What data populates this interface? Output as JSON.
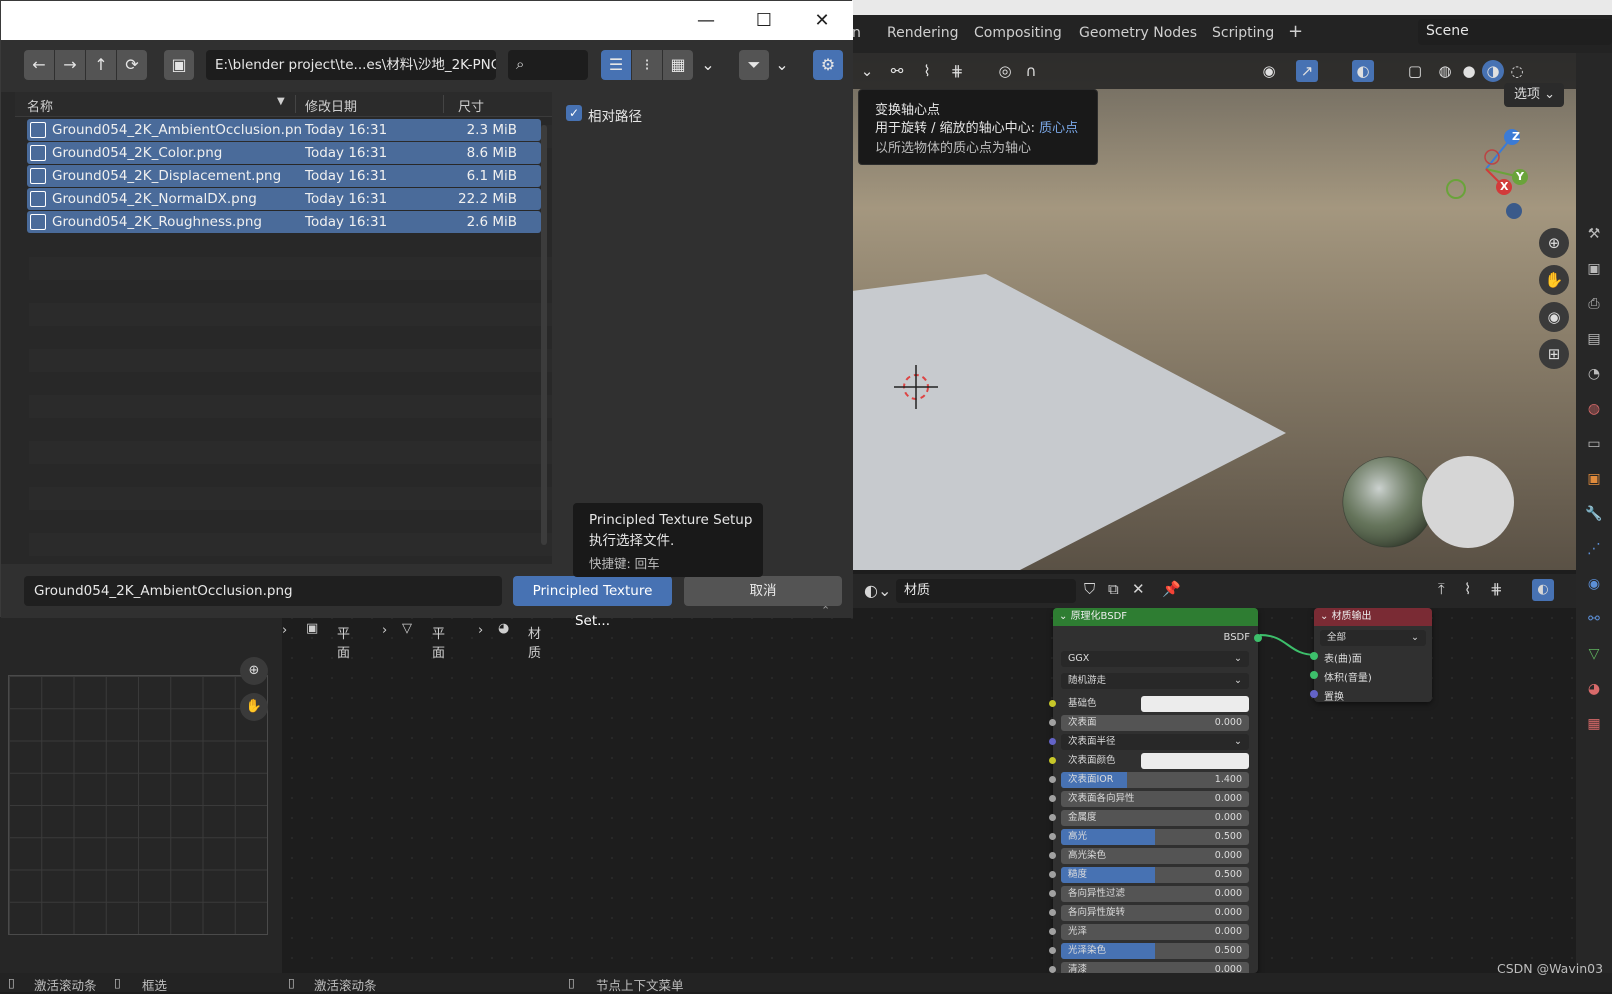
{
  "workspace": {
    "tabs": [
      "n",
      "Rendering",
      "Compositing",
      "Geometry Nodes",
      "Scripting"
    ],
    "add_tab": "+",
    "scene_name": "Scene"
  },
  "viewport": {
    "options_label": "选项",
    "tooltip": {
      "title": "变换轴心点",
      "line2_prefix": "用于旋转 / 缩放的轴心中心: ",
      "line2_value": "质心点",
      "line3": "以所选物体的质心点为轴心"
    },
    "gizmo": {
      "z": "Z",
      "y": "Y",
      "x": "X"
    },
    "plane_color": "#c7cace",
    "sky_top": "#6c675d",
    "sky_mid": "#a4977f"
  },
  "dialog": {
    "path": "E:\\blender project\\te...es\\材料\\沙地_2K-PNG\\",
    "columns": {
      "name": "名称",
      "date": "修改日期",
      "size": "尺寸"
    },
    "files": [
      {
        "name": "Ground054_2K_AmbientOcclusion.pn",
        "date": "Today 16:31",
        "size": "2.3 MiB"
      },
      {
        "name": "Ground054_2K_Color.png",
        "date": "Today 16:31",
        "size": "8.6 MiB"
      },
      {
        "name": "Ground054_2K_Displacement.png",
        "date": "Today 16:31",
        "size": "6.1 MiB"
      },
      {
        "name": "Ground054_2K_NormalDX.png",
        "date": "Today 16:31",
        "size": "22.2 MiB"
      },
      {
        "name": "Ground054_2K_Roughness.png",
        "date": "Today 16:31",
        "size": "2.6 MiB"
      }
    ],
    "relative_path_label": "相对路径",
    "relative_path_checked": true,
    "filename_value": "Ground054_2K_AmbientOcclusion.png",
    "execute_label": "Principled Texture Set...",
    "cancel_label": "取消",
    "tooltip": {
      "title": "Principled Texture Setup",
      "desc": "执行选择文件.",
      "shortcut": "快捷键: 回车"
    },
    "selection_color": "#4a6b9a",
    "accent": "#4772b3"
  },
  "breadcrumbs": [
    "平面",
    "平面",
    "材质"
  ],
  "node_header": {
    "material_label": "材质"
  },
  "bsdf_node": {
    "title": "原理化BSDF",
    "output": "BSDF",
    "distribution": "GGX",
    "subsurface_method": "随机游走",
    "props": [
      {
        "label": "基础色",
        "type": "color"
      },
      {
        "label": "次表面",
        "value": "0.000"
      },
      {
        "label": "次表面半径",
        "type": "dropdown"
      },
      {
        "label": "次表面颜色",
        "type": "color"
      },
      {
        "label": "次表面IOR",
        "value": "1.400",
        "fill": 1.0
      },
      {
        "label": "次表面各向异性",
        "value": "0.000"
      },
      {
        "label": "金属度",
        "value": "0.000"
      },
      {
        "label": "高光",
        "value": "0.500",
        "fill": 0.5
      },
      {
        "label": "高光染色",
        "value": "0.000"
      },
      {
        "label": "糙度",
        "value": "0.500",
        "fill": 0.5
      },
      {
        "label": "各向异性过滤",
        "value": "0.000"
      },
      {
        "label": "各向异性旋转",
        "value": "0.000"
      },
      {
        "label": "光泽",
        "value": "0.000"
      },
      {
        "label": "光泽染色",
        "value": "0.500",
        "fill": 0.5
      },
      {
        "label": "清漆",
        "value": "0.000"
      }
    ]
  },
  "output_node": {
    "title": "材质输出",
    "target": "全部",
    "inputs": [
      "表(曲)面",
      "体积(音量)",
      "置换"
    ]
  },
  "statusbar": {
    "items": [
      "激活滚动条",
      "框选",
      "激活滚动条",
      "节点上下文菜单"
    ],
    "watermark": "CSDN @Wavin03"
  }
}
